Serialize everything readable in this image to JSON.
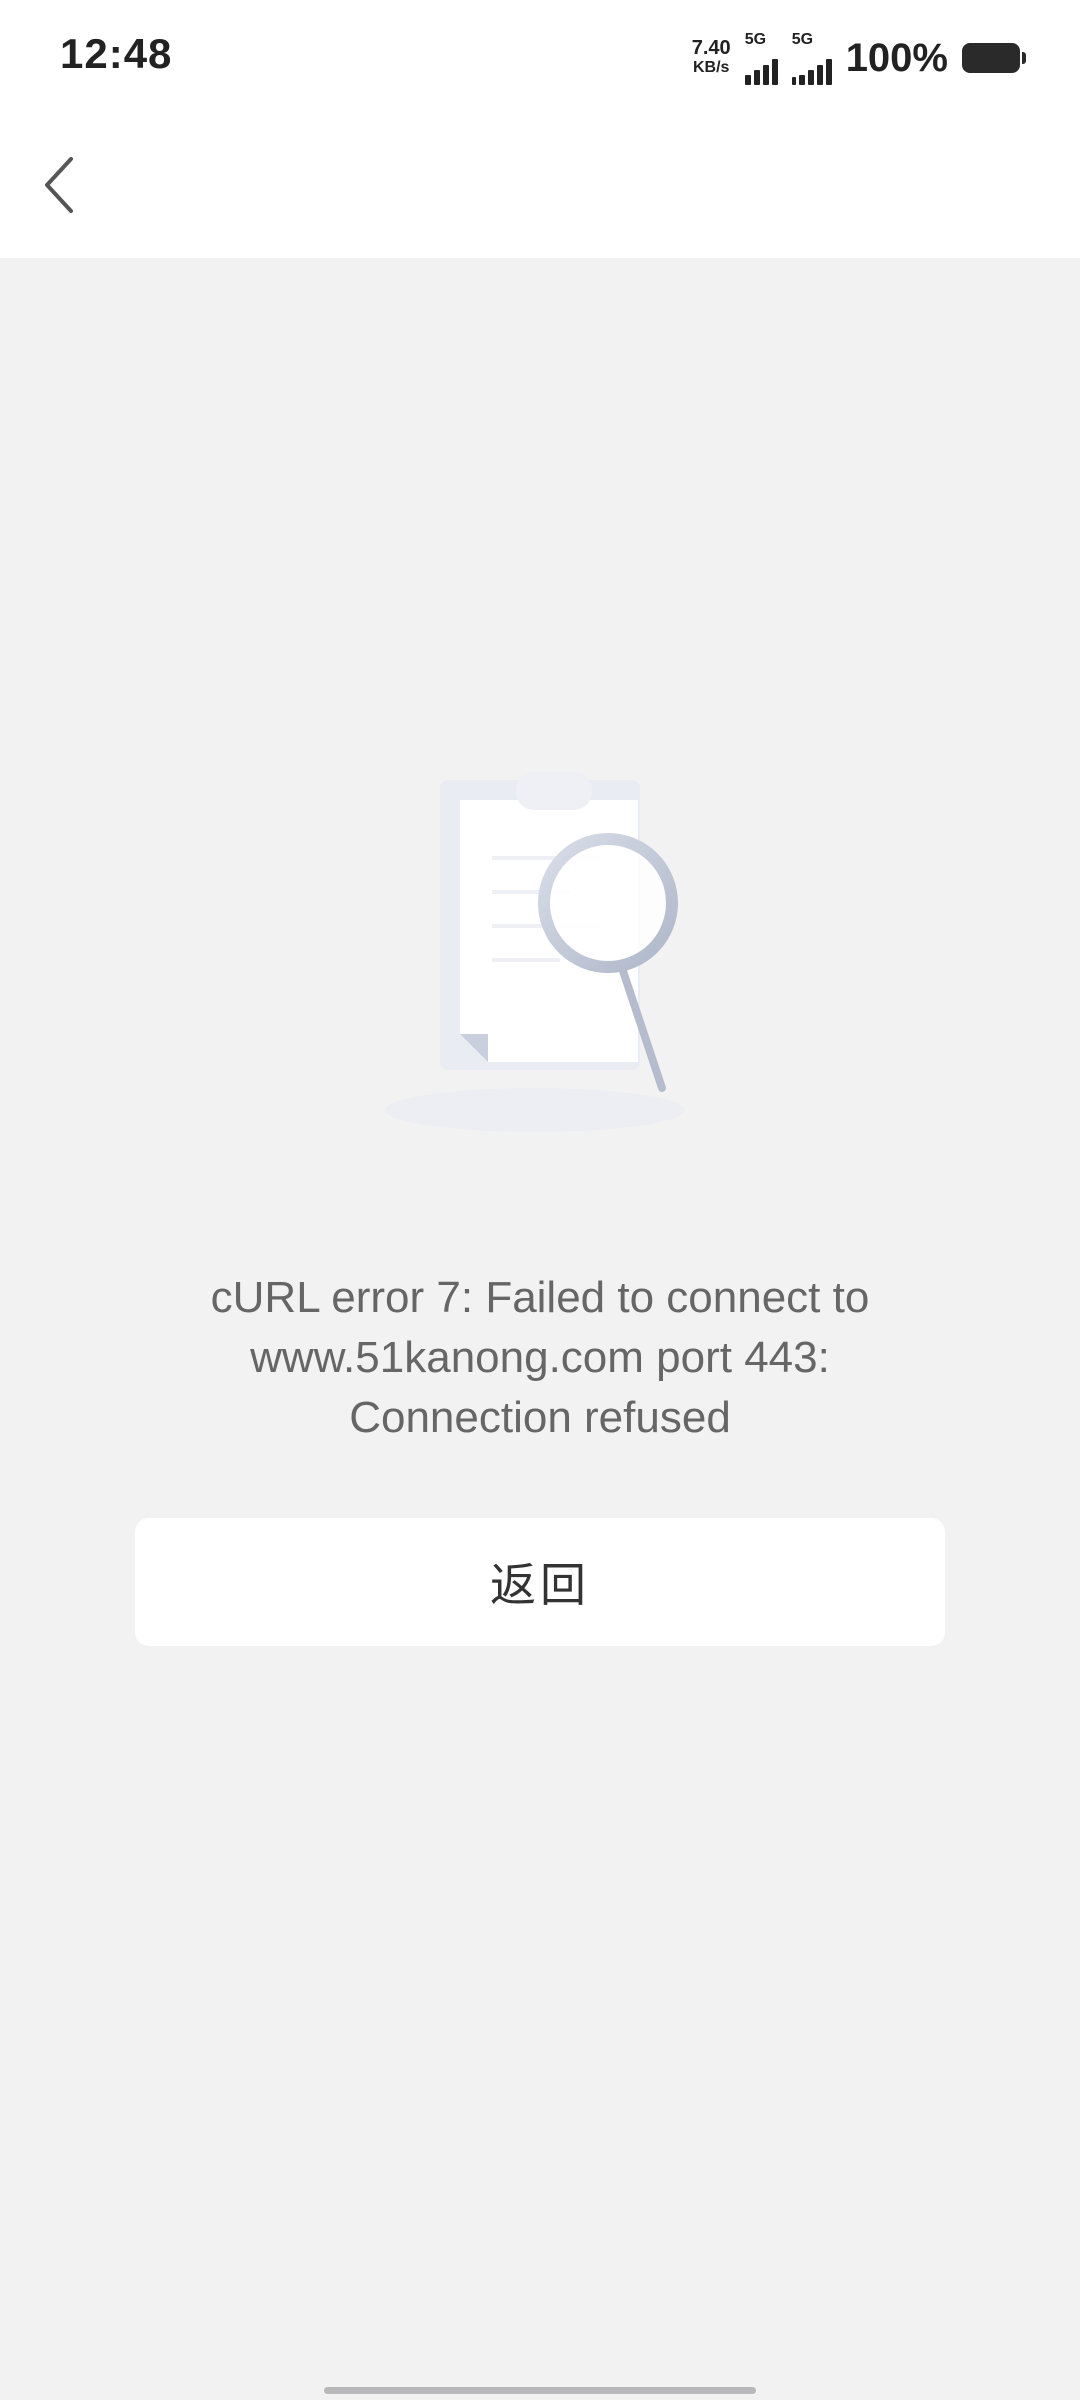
{
  "status_bar": {
    "time": "12:48",
    "net_speed_value": "7.40",
    "net_speed_unit": "KB/s",
    "sim1_label": "5G",
    "sim2_label": "5G",
    "battery_percent": "100%"
  },
  "nav": {
    "back_icon": "chevron-left-icon"
  },
  "empty_state": {
    "illustration_icon": "clipboard-search-icon",
    "message": "cURL error 7: Failed to connect to www.51kanong.com port 443: Connection refused"
  },
  "actions": {
    "return_label": "返回"
  },
  "colors": {
    "background": "#f2f2f3",
    "surface": "#ffffff",
    "text_secondary": "#666666",
    "text_primary": "#333333"
  }
}
